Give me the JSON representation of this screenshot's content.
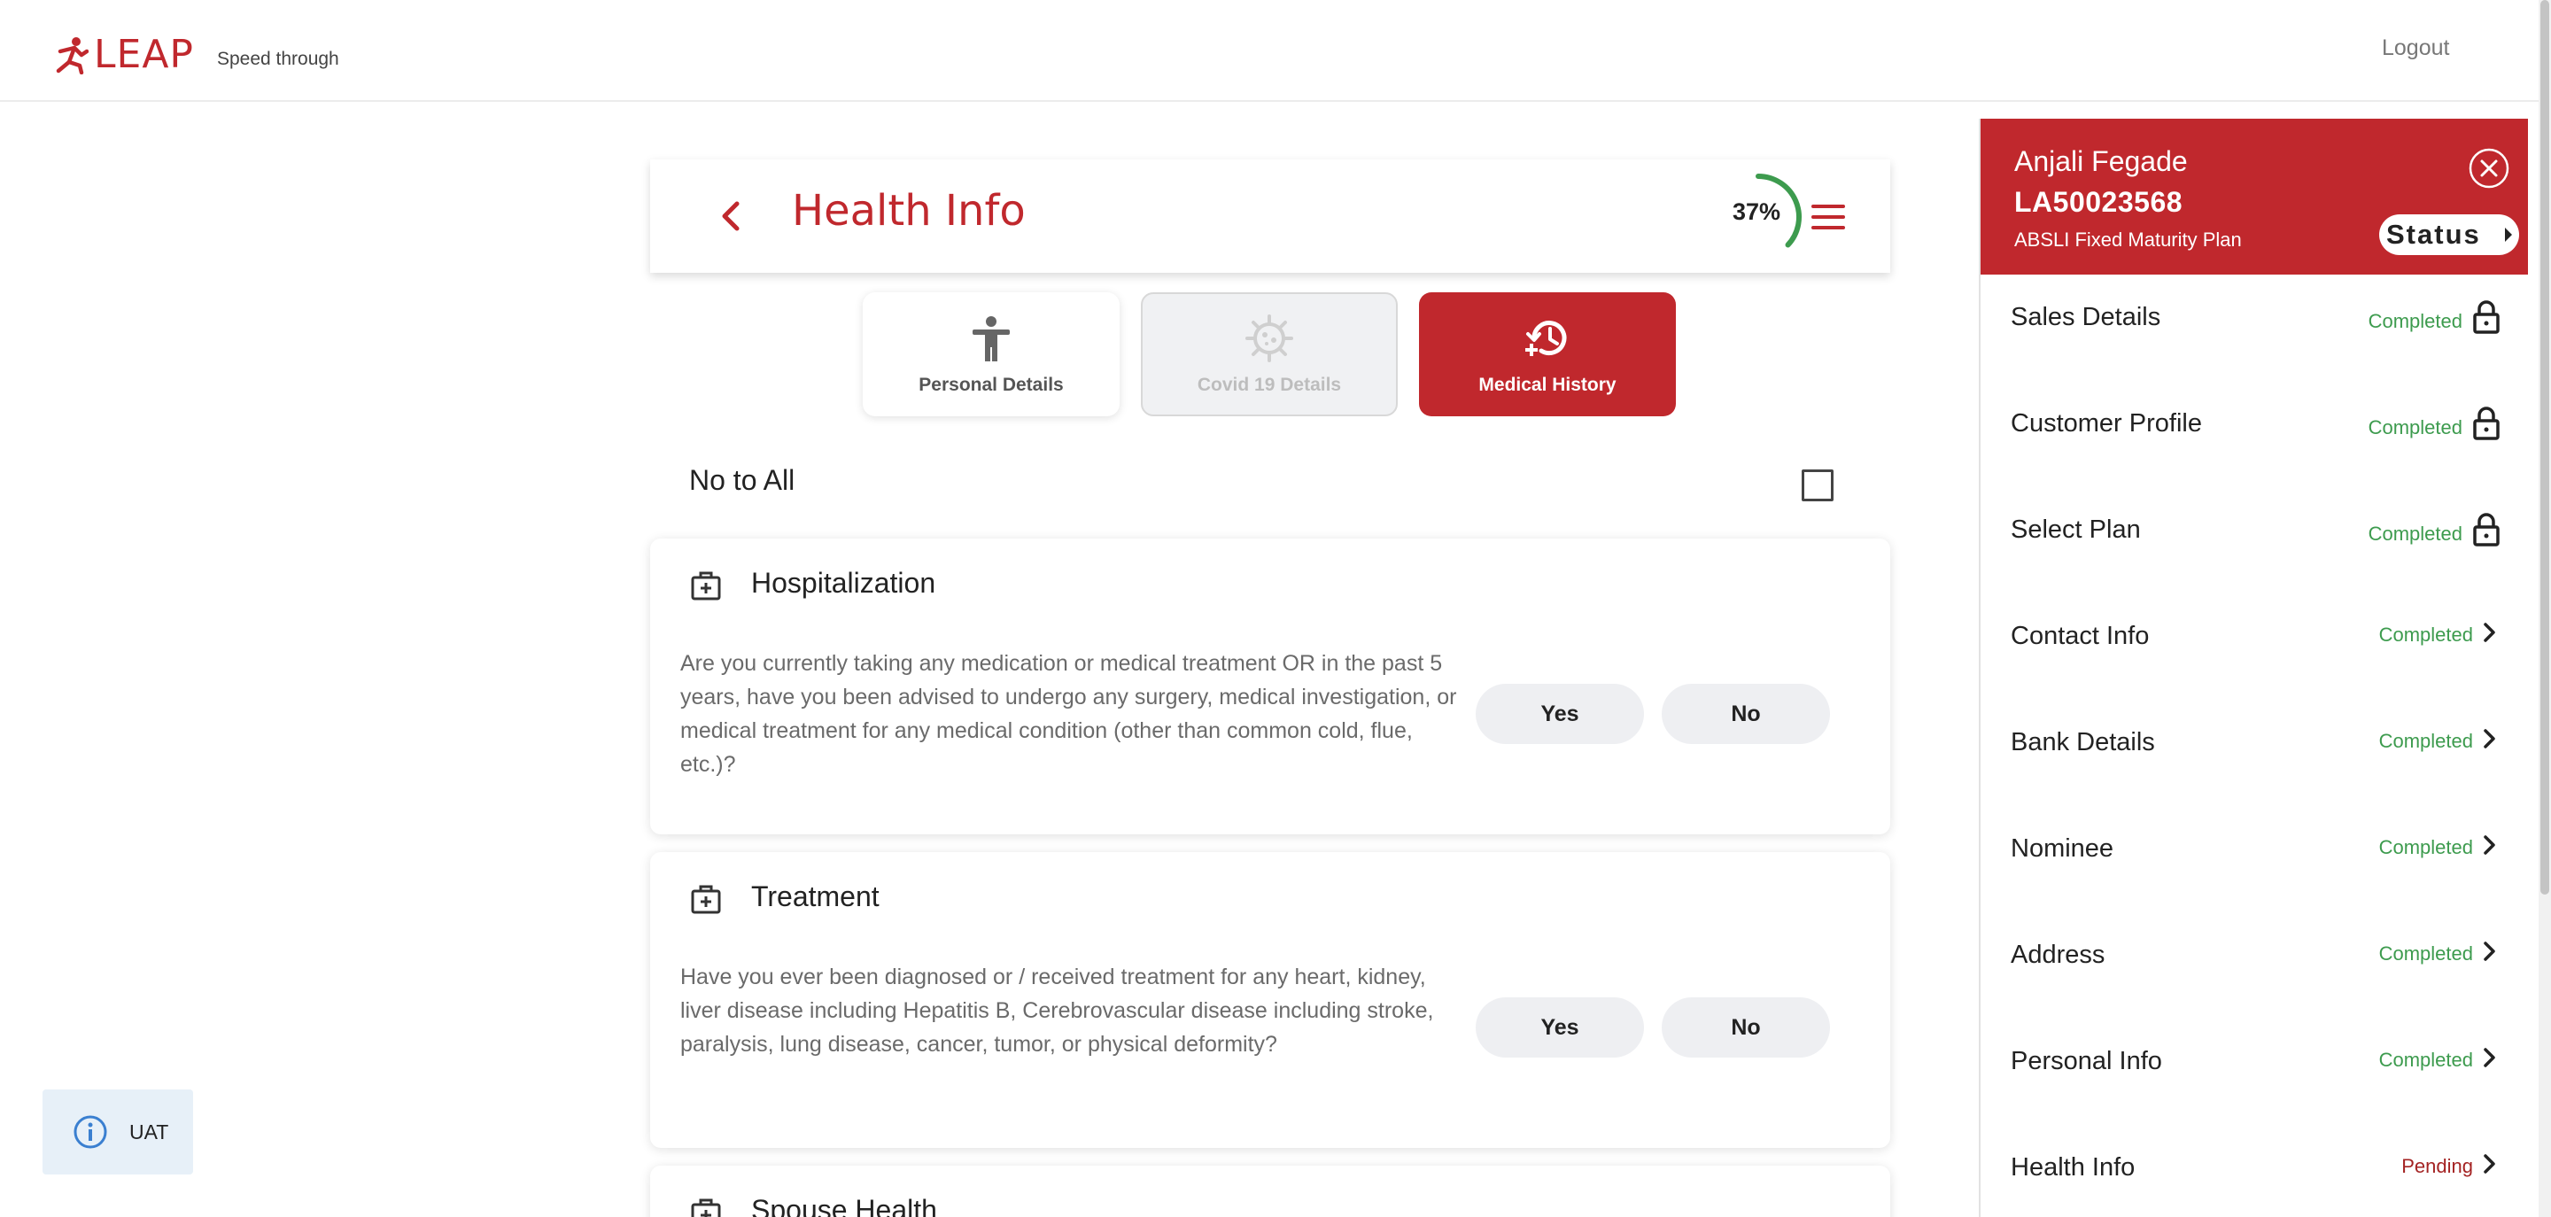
{
  "header": {
    "brand": "LEAP",
    "tagline": "Speed through",
    "logout_label": "Logout"
  },
  "page": {
    "title": "Health Info",
    "progress_text": "37%",
    "progress_value": 0.37
  },
  "tabs": [
    {
      "label": "Personal Details",
      "state": "inactive",
      "icon": "person-icon"
    },
    {
      "label": "Covid 19 Details",
      "state": "disabled",
      "icon": "virus-icon"
    },
    {
      "label": "Medical History",
      "state": "active",
      "icon": "history-icon"
    }
  ],
  "no_to_all": {
    "label": "No to All",
    "checked": false
  },
  "questions": [
    {
      "title": "Hospitalization",
      "text": "Are you currently taking any medication or medical treatment OR in the past 5 years, have you been advised to undergo any surgery, medical investigation, or medical treatment for any medical condition (other than common cold, flue, etc.)?",
      "yes_label": "Yes",
      "no_label": "No"
    },
    {
      "title": "Treatment",
      "text": "Have you ever been diagnosed or / received treatment for any heart, kidney, liver disease including Hepatitis B, Cerebrovascular disease including stroke, paralysis, lung disease, cancer, tumor, or physical deformity?",
      "yes_label": "Yes",
      "no_label": "No"
    },
    {
      "title": "Spouse Health"
    }
  ],
  "env_badge": {
    "label": "UAT"
  },
  "panel": {
    "customer_name": "Anjali Fegade",
    "application_id": "LA50023568",
    "plan_name": "ABSLI Fixed Maturity Plan",
    "status_label": "Status",
    "steps": [
      {
        "label": "Sales Details",
        "status": "Completed",
        "locked": true
      },
      {
        "label": "Customer Profile",
        "status": "Completed",
        "locked": true
      },
      {
        "label": "Select Plan",
        "status": "Completed",
        "locked": true
      },
      {
        "label": "Contact Info",
        "status": "Completed",
        "locked": false
      },
      {
        "label": "Bank Details",
        "status": "Completed",
        "locked": false
      },
      {
        "label": "Nominee",
        "status": "Completed",
        "locked": false
      },
      {
        "label": "Address",
        "status": "Completed",
        "locked": false
      },
      {
        "label": "Personal Info",
        "status": "Completed",
        "locked": false
      },
      {
        "label": "Health Info",
        "status": "Pending",
        "locked": false
      }
    ]
  },
  "colors": {
    "brand_red": "#c0282d",
    "completed_green": "#3d9b4e",
    "pending_red": "#a42323",
    "progress_green": "#3d9b4e"
  }
}
